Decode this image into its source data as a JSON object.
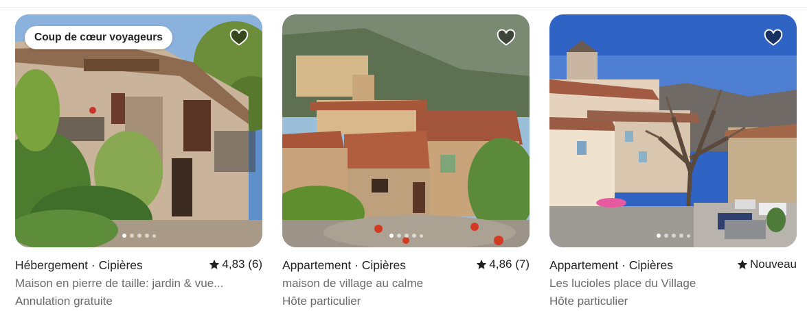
{
  "listings": [
    {
      "badge": "Coup de cœur voyageurs",
      "title": "Hébergement · Cipières",
      "rating": "4,83 (6)",
      "description": "Maison en pierre de taille: jardin & vue...",
      "extra": "Annulation gratuite",
      "icons": {
        "favorite": "heart-icon",
        "rating": "star-icon"
      }
    },
    {
      "title": "Appartement · Cipières",
      "rating": "4,86 (7)",
      "description": "maison de village au calme",
      "extra": "Hôte particulier",
      "icons": {
        "favorite": "heart-icon",
        "rating": "star-icon"
      }
    },
    {
      "title": "Appartement · Cipières",
      "rating": "Nouveau",
      "description": "Les lucioles place du Village",
      "extra": "Hôte particulier",
      "icons": {
        "favorite": "heart-icon",
        "rating": "star-icon"
      }
    }
  ]
}
